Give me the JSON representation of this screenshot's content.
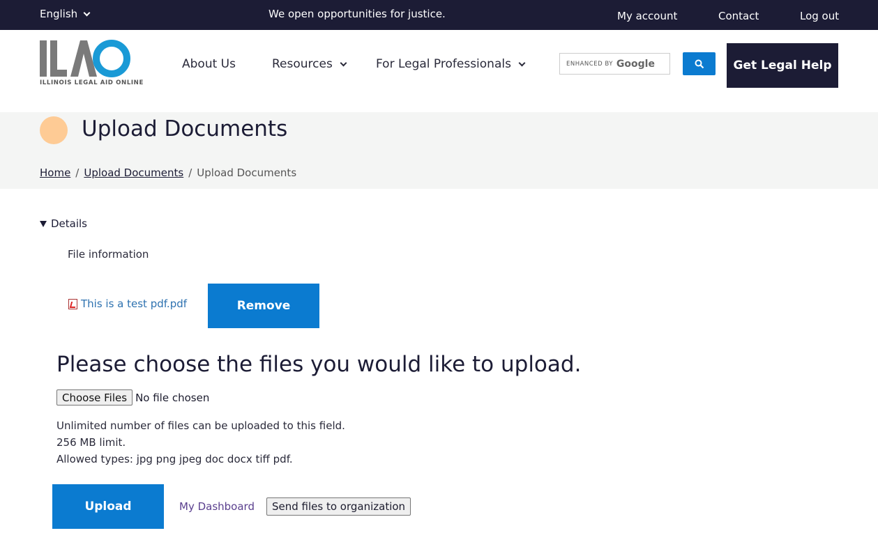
{
  "topbar": {
    "language": "English",
    "tagline": "We open opportunities for justice.",
    "links": [
      "My account",
      "Contact",
      "Log out"
    ]
  },
  "header": {
    "logo_letters": "ILAO",
    "logo_subtitle": "ILLINOIS LEGAL AID ONLINE",
    "nav": [
      "About Us",
      "Resources",
      "For Legal Professionals"
    ],
    "search_enhanced": "ENHANCED BY",
    "search_google": "Google",
    "cta": "Get Legal Help"
  },
  "hero": {
    "title": "Upload Documents",
    "breadcrumb": [
      "Home",
      "Upload Documents",
      "Upload Documents"
    ]
  },
  "details": {
    "summary": "Details",
    "file_info_label": "File information",
    "file_name": "This is a test pdf.pdf",
    "remove_label": "Remove"
  },
  "upload": {
    "heading": "Please choose the files you would like to upload.",
    "choose_label": "Choose Files",
    "no_file": "No file chosen",
    "help": [
      "Unlimited number of files can be uploaded to this field.",
      "256 MB limit.",
      "Allowed types: jpg png jpeg doc docx tiff pdf."
    ],
    "upload_label": "Upload",
    "dashboard_label": "My Dashboard",
    "send_label": "Send files to organization"
  },
  "colors": {
    "navy": "#1c1c35",
    "accent_blue": "#0b7bd0",
    "hero_bg": "#f4f5f4",
    "dot": "#fecb95",
    "link_blue": "#2e72b0"
  }
}
